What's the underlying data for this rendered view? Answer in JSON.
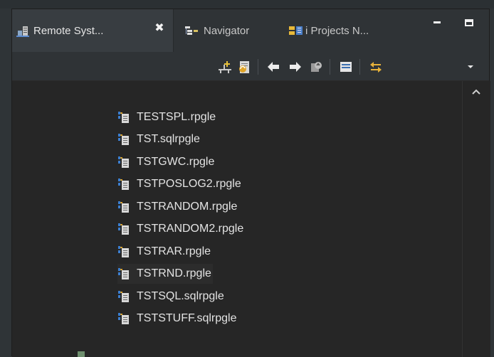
{
  "tabs": [
    {
      "label": "Remote Syst...",
      "icon": "remote-systems-icon",
      "active": true
    },
    {
      "label": "Navigator",
      "icon": "navigator-icon",
      "active": false
    },
    {
      "label": "i Projects N...",
      "icon": "i-projects-icon",
      "active": false
    }
  ],
  "tab_close_label": "✖",
  "toolbar_icons": [
    "new-connection-icon",
    "refresh-icon",
    "back-icon",
    "forward-icon",
    "up-icon",
    "collapse-all-icon",
    "link-with-editor-icon",
    "view-menu-icon"
  ],
  "files": [
    {
      "name": "TESTSPL.rpgle"
    },
    {
      "name": "TST.sqlrpgle"
    },
    {
      "name": "TSTGWC.rpgle"
    },
    {
      "name": "TSTPOSLOG2.rpgle"
    },
    {
      "name": "TSTRANDOM.rpgle"
    },
    {
      "name": "TSTRANDOM2.rpgle"
    },
    {
      "name": "TSTRAR.rpgle"
    },
    {
      "name": "TSTRND.rpgle",
      "selected": true
    },
    {
      "name": "TSTSQL.sqlrpgle"
    },
    {
      "name": "TSTSTUFF.sqlrpgle"
    }
  ],
  "colors": {
    "view_bg": "#262626",
    "tab_active_bg": "#383d41",
    "toolbar_bg": "#2f3336",
    "icon_blue": "#3c7fd0",
    "icon_gold": "#d8a230",
    "text": "#e3e3e3"
  }
}
